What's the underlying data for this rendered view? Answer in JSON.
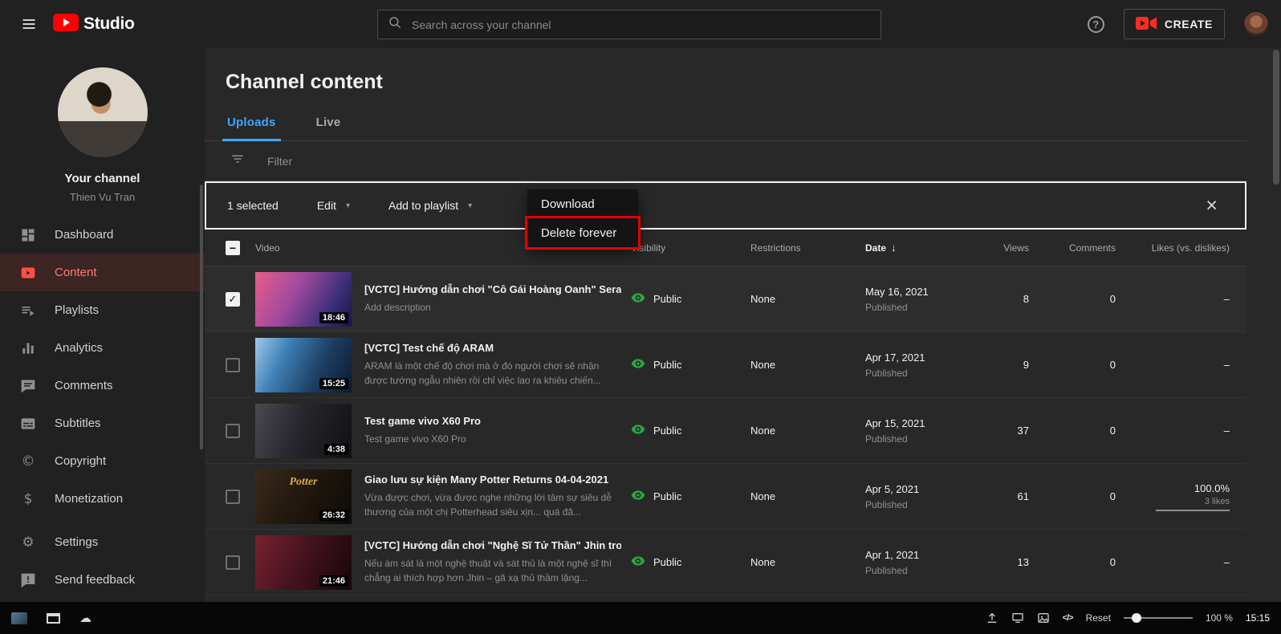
{
  "topbar": {
    "product_name": "Studio",
    "search": {
      "placeholder": "Search across your channel"
    },
    "create_label": "CREATE"
  },
  "sidebar": {
    "channel_title": "Your channel",
    "channel_owner": "Thien Vu Tran",
    "items": [
      {
        "label": "Dashboard"
      },
      {
        "label": "Content"
      },
      {
        "label": "Playlists"
      },
      {
        "label": "Analytics"
      },
      {
        "label": "Comments"
      },
      {
        "label": "Subtitles"
      },
      {
        "label": "Copyright"
      },
      {
        "label": "Monetization"
      },
      {
        "label": "Settings"
      },
      {
        "label": "Send feedback"
      }
    ]
  },
  "page": {
    "title": "Channel content",
    "tabs": [
      {
        "label": "Uploads",
        "active": true
      },
      {
        "label": "Live",
        "active": false
      }
    ],
    "filter_label": "Filter",
    "selection_toolbar": {
      "selected_count": "1 selected",
      "edit_label": "Edit",
      "add_to_playlist_label": "Add to playlist"
    },
    "context_menu": {
      "items": [
        {
          "label": "Download",
          "highlighted": false
        },
        {
          "label": "Delete forever",
          "highlighted": true
        }
      ]
    },
    "table": {
      "headers": {
        "video": "Video",
        "visibility": "Visibility",
        "restrictions": "Restrictions",
        "date": "Date",
        "views": "Views",
        "comments": "Comments",
        "likes": "Likes (vs. dislikes)"
      },
      "rows": [
        {
          "title": "[VCTC] Hướng dẫn chơi \"Cô Gái Hoàng Oanh\" Sera...",
          "description": "Add description",
          "duration": "18:46",
          "visibility": "Public",
          "restrictions": "None",
          "date": "May 16, 2021",
          "date_status": "Published",
          "views": "8",
          "comments": "0",
          "likes": "–",
          "checked": true
        },
        {
          "title": "[VCTC] Test chế độ ARAM",
          "description": "ARAM là một chế độ chơi mà ở đó người chơi sẽ nhận được tướng ngẫu nhiên rồi chỉ việc lao ra khiêu chiến...",
          "duration": "15:25",
          "visibility": "Public",
          "restrictions": "None",
          "date": "Apr 17, 2021",
          "date_status": "Published",
          "views": "9",
          "comments": "0",
          "likes": "–",
          "checked": false
        },
        {
          "title": "Test game vivo X60 Pro",
          "description": "Test game vivo X60 Pro",
          "duration": "4:38",
          "visibility": "Public",
          "restrictions": "None",
          "date": "Apr 15, 2021",
          "date_status": "Published",
          "views": "37",
          "comments": "0",
          "likes": "–",
          "checked": false
        },
        {
          "title": "Giao lưu sự kiện Many Potter Returns 04-04-2021",
          "description": "Vừa được chơi, vừa được nghe những lời tâm sự siêu dễ thương của một chị Potterhead siêu xịn... quá đã...",
          "duration": "26:32",
          "thumb_text": "Potter",
          "visibility": "Public",
          "restrictions": "None",
          "date": "Apr 5, 2021",
          "date_status": "Published",
          "views": "61",
          "comments": "0",
          "likes": "100.0%",
          "likes_sub": "3 likes",
          "checked": false
        },
        {
          "title": "[VCTC] Hướng dẫn chơi \"Nghệ Sĩ Tử Thần\" Jhin tro...",
          "description": "Nếu ám sát là một nghệ thuật và sát thủ là một nghệ sĩ thì chẳng ai thích hợp hơn Jhin – gã xạ thủ thầm lặng...",
          "duration": "21:46",
          "visibility": "Public",
          "restrictions": "None",
          "date": "Apr 1, 2021",
          "date_status": "Published",
          "views": "13",
          "comments": "0",
          "likes": "–",
          "checked": false
        }
      ]
    }
  },
  "statusbar": {
    "reset_label": "Reset",
    "zoom_level": "100 %",
    "clock": "15:15"
  },
  "glyphs": {
    "help": "?",
    "close": "×",
    "caret_down": "▾",
    "sort_down": "↓",
    "copyright": "©",
    "dollar": "$",
    "gear": "⚙",
    "cloud": "☁",
    "code": "</>"
  },
  "colors": {
    "accent_blue": "#3ea6ff",
    "brand_red": "#ff0000",
    "selected_red": "#ff4e45",
    "public_green": "#2ba640",
    "highlight_red": "#e60000"
  }
}
